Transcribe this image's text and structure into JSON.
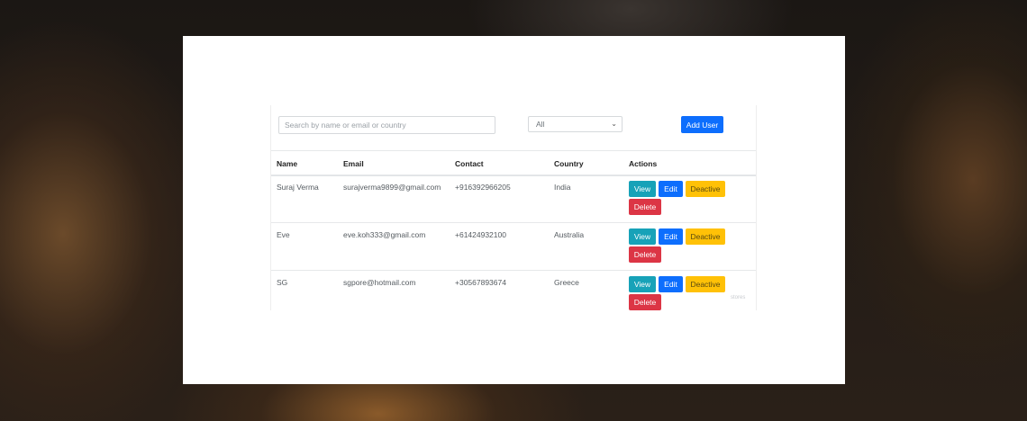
{
  "toolbar": {
    "search_placeholder": "Search by name or email or country",
    "filter_selected": "All",
    "add_user_label": "Add User"
  },
  "table": {
    "headers": {
      "name": "Name",
      "email": "Email",
      "contact": "Contact",
      "country": "Country",
      "actions": "Actions"
    },
    "rows": [
      {
        "name": "Suraj Verma",
        "email": "surajverma9899@gmail.com",
        "contact": "+916392966205",
        "country": "India"
      },
      {
        "name": "Eve",
        "email": "eve.koh333@gmail.com",
        "contact": "+61424932100",
        "country": "Australia"
      },
      {
        "name": "SG",
        "email": "sgpore@hotmail.com",
        "contact": "+30567893674",
        "country": "Greece"
      }
    ],
    "action_labels": {
      "view": "View",
      "edit": "Edit",
      "deactive": "Deactive",
      "delete": "Delete"
    }
  },
  "watermark": "stores",
  "colors": {
    "primary": "#0d6efd",
    "info": "#17a2b8",
    "warning": "#ffc107",
    "danger": "#dc3545"
  },
  "icons": {
    "select_arrow": "chevron-down-icon"
  }
}
